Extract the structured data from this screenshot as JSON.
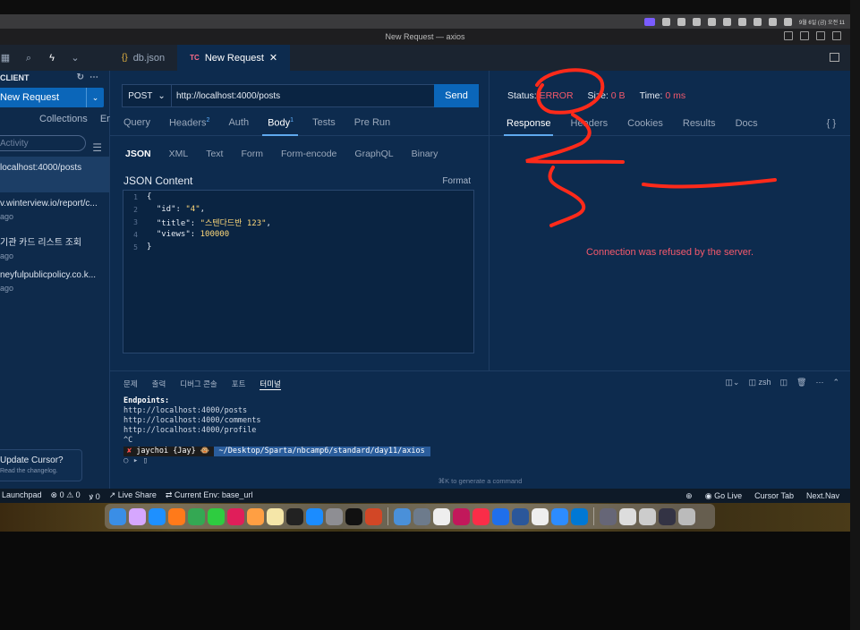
{
  "menubar": {
    "date": "9월 6일 (금) 오전 11"
  },
  "window": {
    "title": "New Request — axios"
  },
  "tabs": [
    {
      "label": "db.json",
      "icon": "braces-icon"
    },
    {
      "label": "New Request",
      "badge": "TC",
      "active": true
    }
  ],
  "sidebar": {
    "header": "CLIENT",
    "new_request": "New Request",
    "tabs": [
      "Collections",
      "Env"
    ],
    "search_placeholder": "Activity",
    "items": [
      {
        "title": "localhost:4000/posts",
        "sub": ""
      },
      {
        "title": "v.winterview.io/report/c...",
        "sub": "ago"
      },
      {
        "title": "기관 카드 리스트 조회",
        "sub": "ago"
      },
      {
        "title": "neyfulpublicpolicy.co.k...",
        "sub": "ago"
      }
    ],
    "update_title": "Update Cursor?",
    "update_sub": "Read the changelog."
  },
  "request": {
    "method": "POST",
    "url": "http://localhost:4000/posts",
    "send": "Send",
    "tabs": {
      "query": "Query",
      "headers": "Headers",
      "headers_count": "2",
      "auth": "Auth",
      "body": "Body",
      "body_count": "1",
      "tests": "Tests",
      "prerun": "Pre Run"
    },
    "body_types": [
      "JSON",
      "XML",
      "Text",
      "Form",
      "Form-encode",
      "GraphQL",
      "Binary"
    ],
    "json_label": "JSON Content",
    "format": "Format",
    "code": {
      "l1": "{",
      "l2_key": "\"id\"",
      "l2_val": "\"4\"",
      "l3_key": "\"title\"",
      "l3_val": "\"스텐다드반 123\"",
      "l4_key": "\"views\"",
      "l4_val": "100000",
      "l5": "}"
    },
    "line_numbers": [
      "1",
      "2",
      "3",
      "4",
      "5"
    ]
  },
  "response": {
    "status_label": "Status:",
    "status_value": "ERROR",
    "size_label": "Size:",
    "size_value": "0 B",
    "time_label": "Time:",
    "time_value": "0 ms",
    "tabs": [
      "Response",
      "Headers",
      "Cookies",
      "Results",
      "Docs"
    ],
    "error_message": "Connection was refused by the server."
  },
  "terminal": {
    "tabs": [
      "문제",
      "출력",
      "디버그 콘솔",
      "포트",
      "터미널"
    ],
    "shell": "zsh",
    "lines": {
      "endpoints": "Endpoints:",
      "e1": "http://localhost:4000/posts",
      "e2": "http://localhost:4000/comments",
      "e3": "http://localhost:4000/profile",
      "ctrlc": "^C"
    },
    "prompt_user": "jaychoi {Jay}",
    "prompt_path": "~/Desktop/Sparta/nbcamp6/standard/day11/axios",
    "hint": "⌘K to generate a command"
  },
  "statusbar": {
    "launchpad": "Launchpad",
    "problems": "⊗ 0 ⚠ 0",
    "ports": "0",
    "live_share": "Live Share",
    "env": "Current Env: base_url",
    "go_live": "Go Live",
    "cursor_tab": "Cursor Tab",
    "next": "Next.Nav"
  },
  "colors": {
    "accent": "#0b66b9",
    "error": "#f4596c",
    "panel": "#0d2b4e",
    "scribble": "#ff2a1a"
  }
}
